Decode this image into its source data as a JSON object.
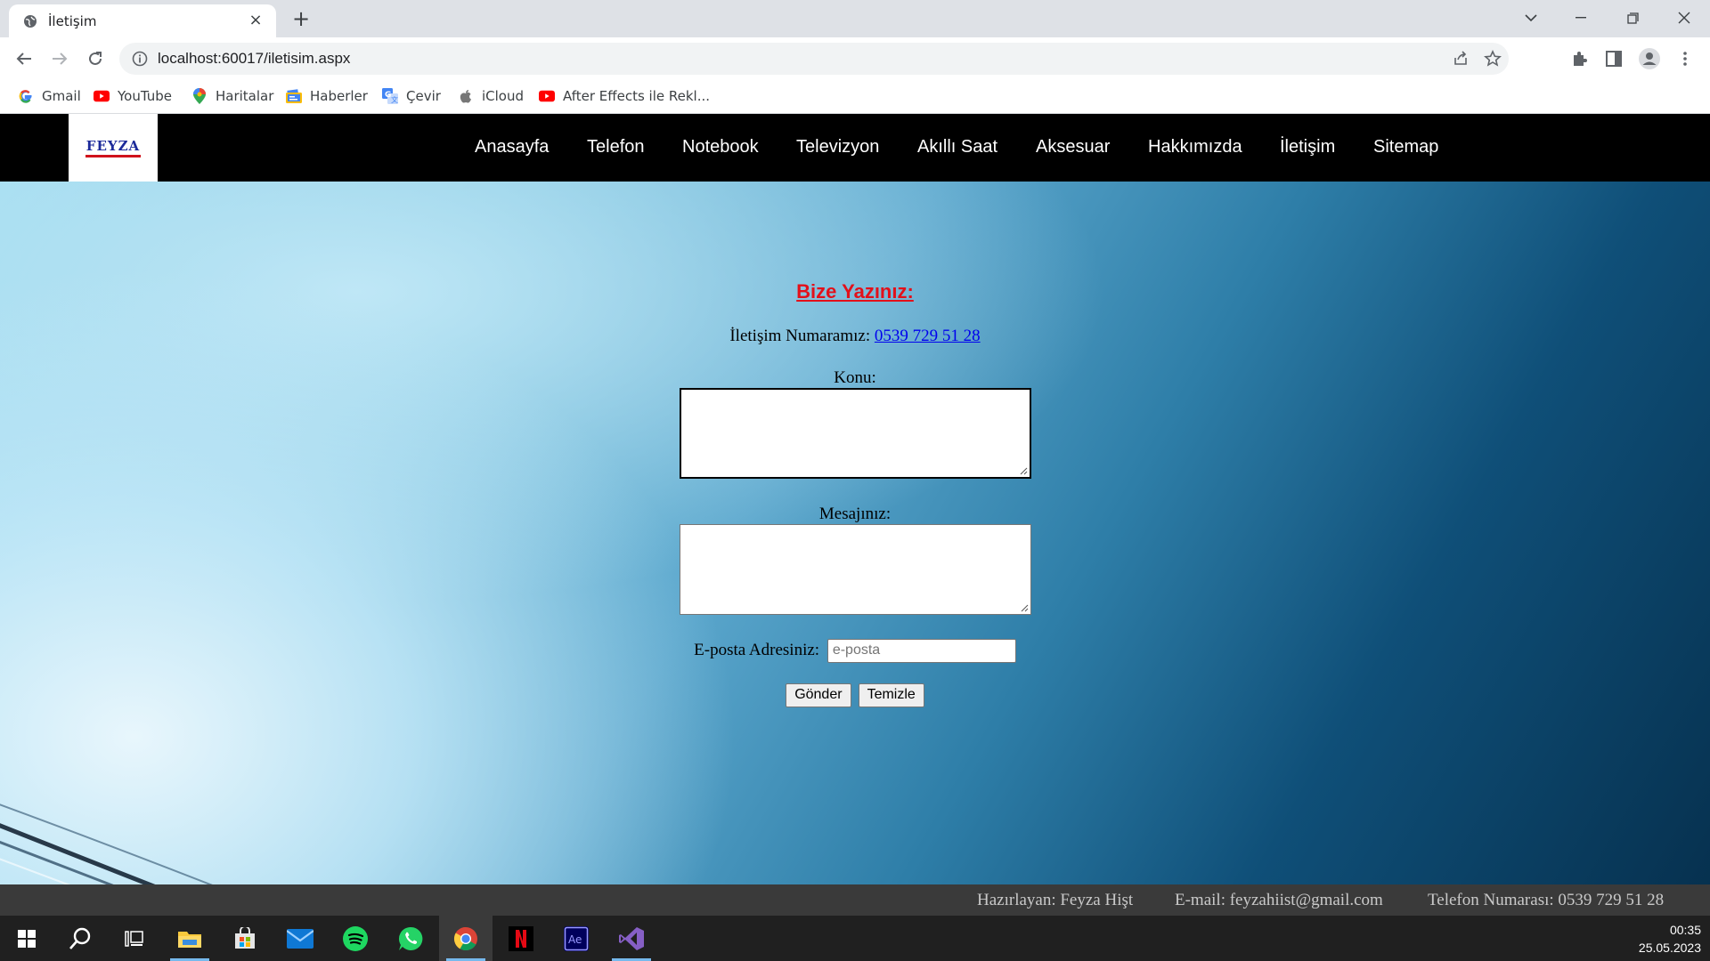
{
  "browser": {
    "tab_title": "İletişim",
    "url": "localhost:60017/iletisim.aspx",
    "bookmarks": [
      "Gmail",
      "YouTube",
      "Haritalar",
      "Haberler",
      "Çevir",
      "iCloud",
      "After Effects ile Rekl..."
    ]
  },
  "site": {
    "logo_text": "FEYZA",
    "menu": [
      "Anasayfa",
      "Telefon",
      "Notebook",
      "Televizyon",
      "Akıllı Saat",
      "Aksesuar",
      "Hakkımızda",
      "İletişim",
      "Sitemap"
    ]
  },
  "form": {
    "heading": "Bize Yazınız:",
    "phone_label": "İletişim Numaramız: ",
    "phone_link": "0539 729 51 28",
    "subject_label": "Konu:",
    "message_label": "Mesajınız:",
    "email_label": "E-posta Adresiniz:",
    "email_placeholder": "e-posta",
    "submit_label": "Gönder",
    "reset_label": "Temizle"
  },
  "footer": {
    "author": "Hazırlayan: Feyza Hişt",
    "email": "E-mail: feyzahiist@gmail.com",
    "phone": "Telefon Numarası: 0539 729 51 28"
  },
  "taskbar": {
    "time": "00:35",
    "date": "25.05.2023",
    "apps": [
      "windows-start",
      "search",
      "task-view",
      "file-explorer",
      "microsoft-store",
      "mail",
      "spotify",
      "whatsapp",
      "chrome",
      "netflix",
      "after-effects",
      "visual-studio"
    ]
  },
  "colors": {
    "heading": "#e3101a",
    "link": "#0000ee",
    "nav_bg": "#000000",
    "footer_bg": "#3a3a3a"
  }
}
